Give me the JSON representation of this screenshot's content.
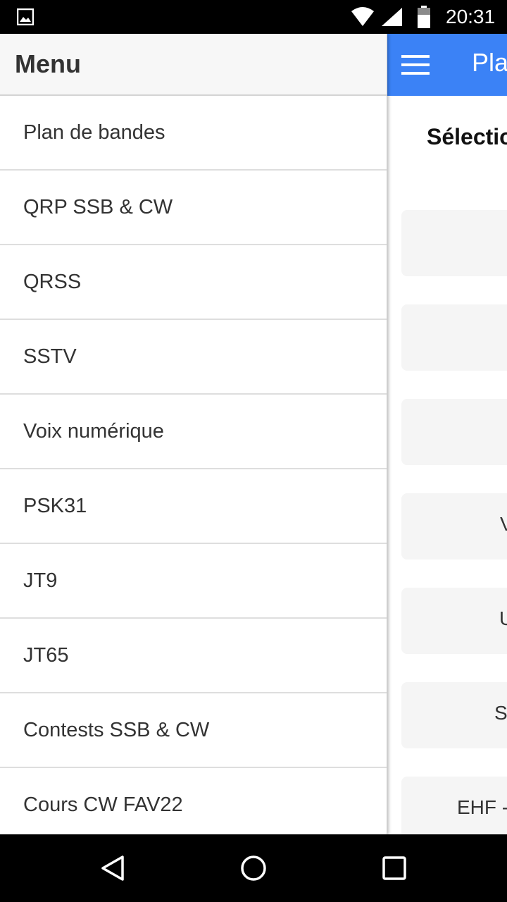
{
  "status_bar": {
    "time": "20:31",
    "icons": [
      "gallery-icon",
      "wifi-icon",
      "signal-icon",
      "battery-icon"
    ]
  },
  "drawer": {
    "title": "Menu",
    "items": [
      {
        "label": "Plan de bandes"
      },
      {
        "label": "QRP SSB & CW"
      },
      {
        "label": "QRSS"
      },
      {
        "label": "SSTV"
      },
      {
        "label": "Voix numérique"
      },
      {
        "label": "PSK31"
      },
      {
        "label": "JT9"
      },
      {
        "label": "JT65"
      },
      {
        "label": "Contests SSB & CW"
      },
      {
        "label": "Cours CW FAV22"
      }
    ]
  },
  "app": {
    "toolbar_title": "Pla",
    "heading": "Sélectio",
    "band_buttons": [
      {
        "label": ""
      },
      {
        "label": ""
      },
      {
        "label": ""
      },
      {
        "label": "V"
      },
      {
        "label": "U"
      },
      {
        "label": "S"
      },
      {
        "label": "EHF -"
      }
    ],
    "colors": {
      "toolbar": "#3b82f6",
      "card": "#f5f5f5"
    }
  },
  "nav_bar": {
    "icons": [
      "back-icon",
      "home-icon",
      "recents-icon"
    ]
  }
}
